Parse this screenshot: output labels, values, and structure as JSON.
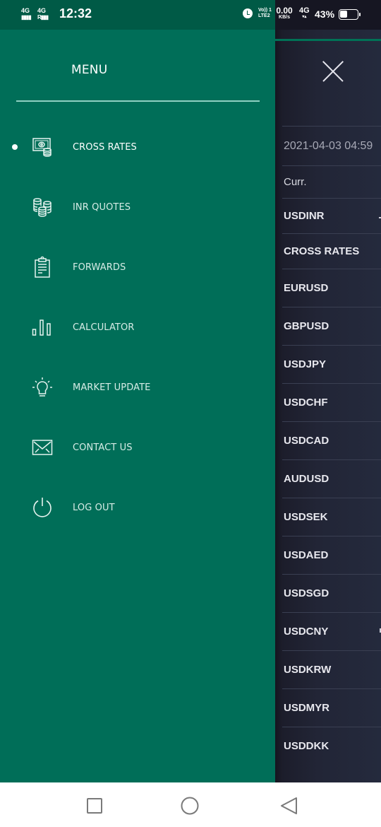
{
  "status_bar": {
    "sim1": "4G",
    "sim2": "4G",
    "sim2_sub": "R",
    "time": "12:32",
    "volte": "Vo)) 1",
    "lte": "LTE2",
    "net_speed": "0.00",
    "net_speed_unit": "KB/s",
    "network_type": "4G",
    "battery_percent": "43%",
    "battery_level": 0.43
  },
  "drawer": {
    "title": "MENU",
    "active_index": 0,
    "items": [
      {
        "label": "CROSS RATES",
        "icon": "money-coins-icon"
      },
      {
        "label": "INR QUOTES",
        "icon": "coin-stacks-icon"
      },
      {
        "label": "FORWARDS",
        "icon": "clipboard-icon"
      },
      {
        "label": "CALCULATOR",
        "icon": "bar-chart-icon"
      },
      {
        "label": "MARKET UPDATE",
        "icon": "lightbulb-icon"
      },
      {
        "label": "CONTACT US",
        "icon": "envelope-icon"
      },
      {
        "label": "LOG OUT",
        "icon": "power-icon"
      }
    ]
  },
  "background_screen": {
    "close_icon": "close-icon",
    "timestamp": "2021-04-03 04:59",
    "column_header": "Curr.",
    "rows": [
      {
        "label": "USDINR",
        "type": "currency"
      },
      {
        "label": "CROSS RATES",
        "type": "section"
      },
      {
        "label": "EURUSD",
        "type": "currency"
      },
      {
        "label": "GBPUSD",
        "type": "currency"
      },
      {
        "label": "USDJPY",
        "type": "currency"
      },
      {
        "label": "USDCHF",
        "type": "currency"
      },
      {
        "label": "USDCAD",
        "type": "currency"
      },
      {
        "label": "AUDUSD",
        "type": "currency"
      },
      {
        "label": "USDSEK",
        "type": "currency"
      },
      {
        "label": "USDAED",
        "type": "currency"
      },
      {
        "label": "USDSGD",
        "type": "currency"
      },
      {
        "label": "USDCNY",
        "type": "currency"
      },
      {
        "label": "USDKRW",
        "type": "currency"
      },
      {
        "label": "USDMYR",
        "type": "currency"
      },
      {
        "label": "USDDKK",
        "type": "currency"
      }
    ]
  },
  "nav_bar": {
    "recents": "recents-square-icon",
    "home": "home-circle-icon",
    "back": "back-triangle-icon"
  },
  "colors": {
    "drawer_bg": "#006e58",
    "status_bar_bg": "#005a46",
    "main_bg": "#222536",
    "accent_line": "#007256"
  }
}
